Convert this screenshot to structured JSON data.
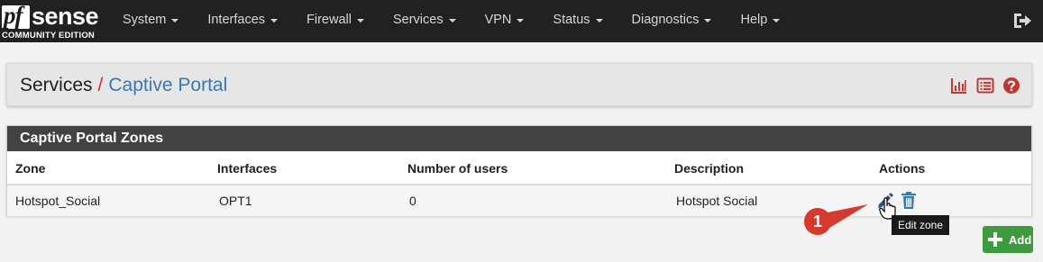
{
  "brand": {
    "logo_pf": "pf",
    "logo_sense": "sense",
    "edition": "COMMUNITY EDITION"
  },
  "nav": {
    "items": [
      {
        "label": "System"
      },
      {
        "label": "Interfaces"
      },
      {
        "label": "Firewall"
      },
      {
        "label": "Services"
      },
      {
        "label": "VPN"
      },
      {
        "label": "Status"
      },
      {
        "label": "Diagnostics"
      },
      {
        "label": "Help"
      }
    ],
    "logout_icon": "sign-out-icon"
  },
  "breadcrumb": {
    "section": "Services",
    "separator": "/",
    "page": "Captive Portal"
  },
  "breadcrumb_icons": [
    "bar-chart-icon",
    "list-icon",
    "question-circle-icon"
  ],
  "panel": {
    "title": "Captive Portal Zones",
    "columns": {
      "zone": "Zone",
      "interfaces": "Interfaces",
      "users": "Number of users",
      "description": "Description",
      "actions": "Actions"
    },
    "rows": [
      {
        "zone": "Hotspot_Social",
        "interfaces": "OPT1",
        "users": "0",
        "description": "Hotspot Social"
      }
    ]
  },
  "tooltip": "Edit zone",
  "annotation": {
    "number": "1"
  },
  "add_button": {
    "label": "Add"
  },
  "colors": {
    "navbar": "#212121",
    "link": "#3678b8",
    "danger": "#c43535",
    "success": "#3e9a3e",
    "panel_head": "#424242"
  }
}
